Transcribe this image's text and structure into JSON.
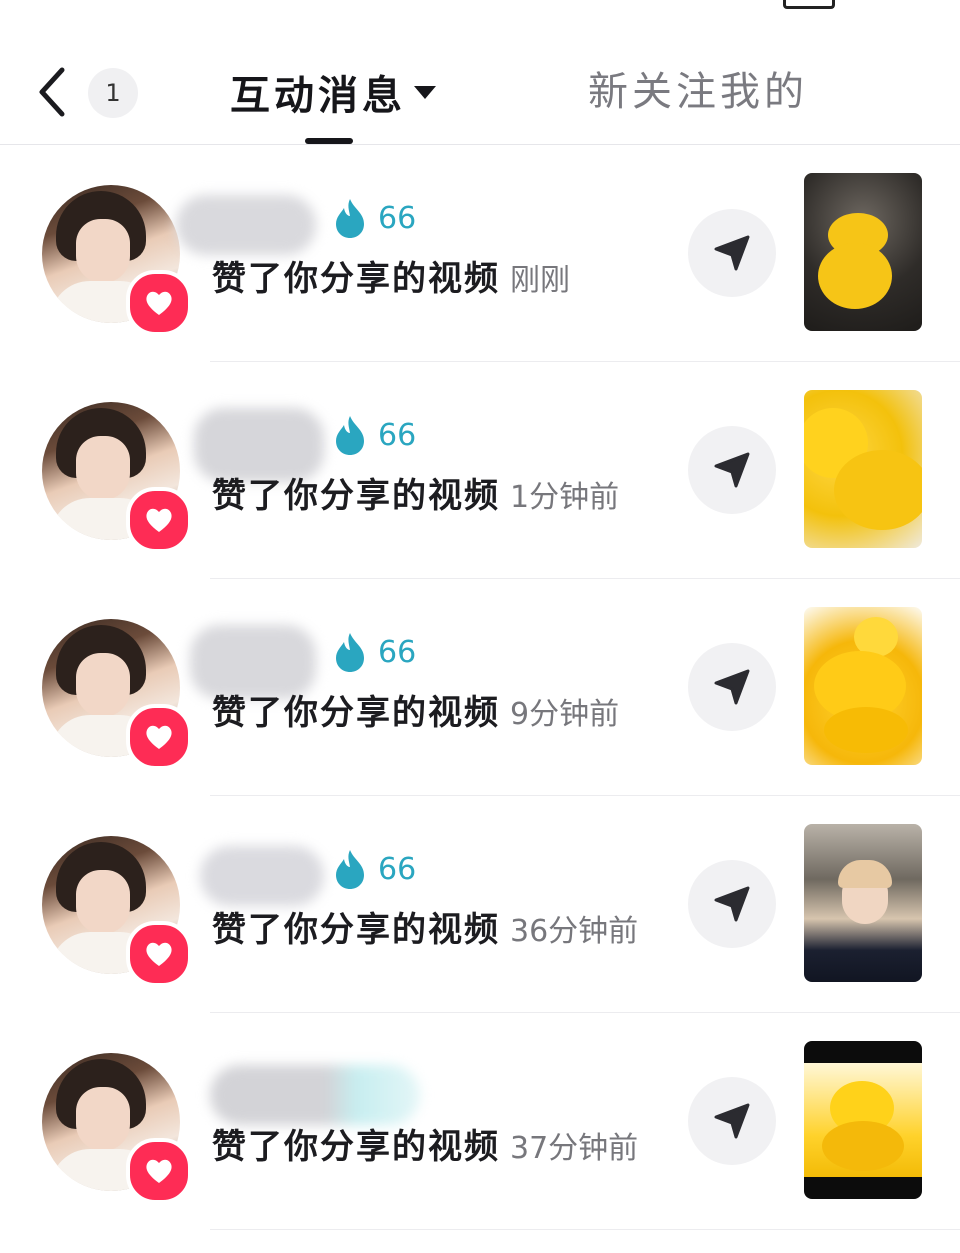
{
  "header": {
    "back_icon": "chevron-left-icon",
    "unread_count": "1",
    "active_tab": "互动消息",
    "other_tab": "新关注我的"
  },
  "colors": {
    "like_red": "#fe2c55",
    "fire_teal": "#2aa6c0",
    "time_gray": "#77777c"
  },
  "notifications": [
    {
      "fire_count": "66",
      "action": "赞了你分享的视频",
      "time": "刚刚",
      "thumb": "yellow-dog-spotlight"
    },
    {
      "fire_count": "66",
      "action": "赞了你分享的视频",
      "time": "1分钟前",
      "thumb": "yellow-dog-closeup"
    },
    {
      "fire_count": "66",
      "action": "赞了你分享的视频",
      "time": "9分钟前",
      "thumb": "two-yellow-dogs"
    },
    {
      "fire_count": "66",
      "action": "赞了你分享的视频",
      "time": "36分钟前",
      "thumb": "person-video"
    },
    {
      "fire_count": "",
      "action": "赞了你分享的视频",
      "time": "37分钟前",
      "thumb": "yellow-dog-captioned"
    }
  ]
}
